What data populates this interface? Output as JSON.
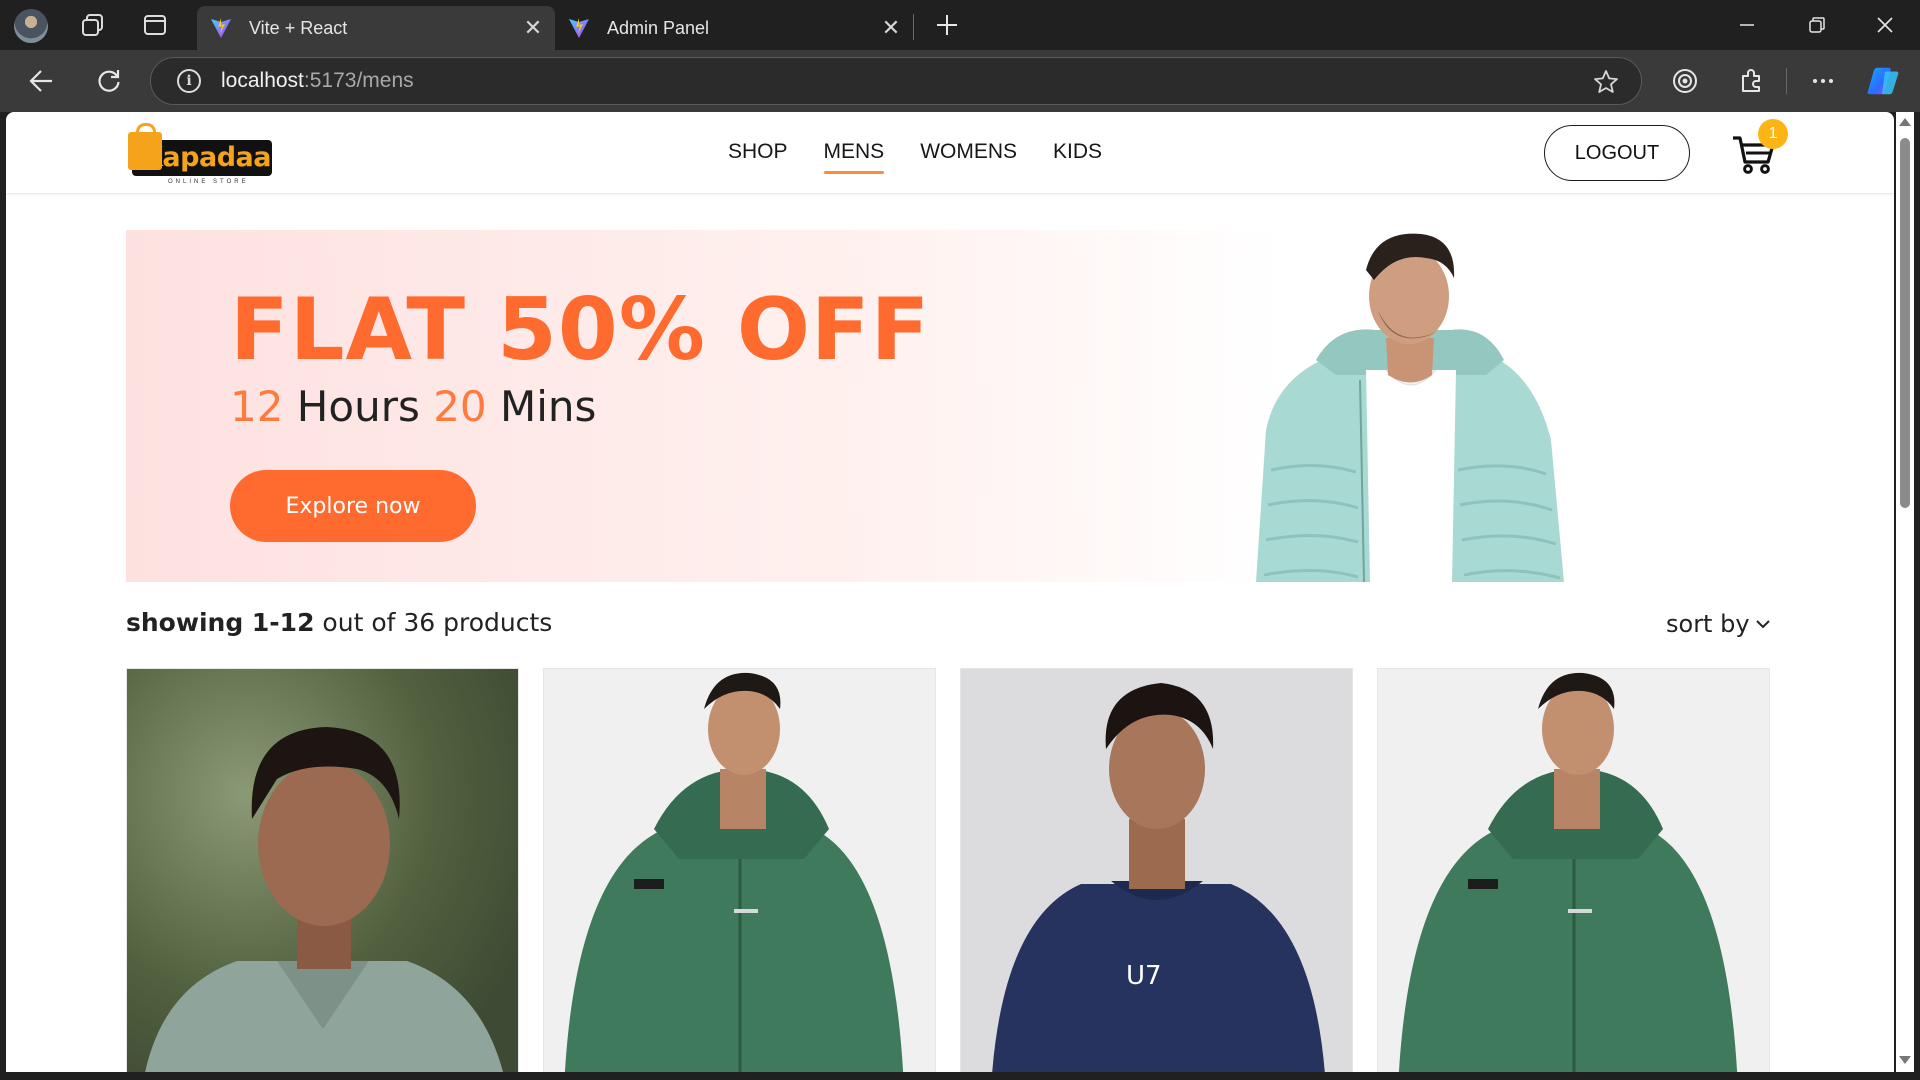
{
  "browser": {
    "tabs": [
      {
        "label": "Vite + React",
        "active": true
      },
      {
        "label": "Admin Panel",
        "active": false
      }
    ],
    "address": {
      "host": "localhost",
      "path": ":5173/mens"
    }
  },
  "navbar": {
    "logo_text": "Kapadaa",
    "logo_subtext": "ONLINE STORE",
    "links": [
      "SHOP",
      "MENS",
      "WOMENS",
      "KIDS"
    ],
    "active_link": "MENS",
    "logout_label": "LOGOUT",
    "cart_count": "1"
  },
  "hero": {
    "title": "FLAT 50% OFF",
    "hours": "12",
    "hours_label": " Hours ",
    "mins": "20",
    "mins_label": " Mins",
    "cta": "Explore now"
  },
  "listing": {
    "showing_bold": "showing 1-12",
    "showing_rest": " out of 36 products",
    "sort_label": "sort by"
  },
  "products": [
    {
      "name": "Grey polo shirt"
    },
    {
      "name": "Green zip hoodie"
    },
    {
      "name": "Navy printed tee"
    },
    {
      "name": "Green zip hoodie"
    }
  ],
  "colors": {
    "accent": "#ff6a2e",
    "badge": "#fdb515",
    "hero_bg": "#fde1e0"
  }
}
